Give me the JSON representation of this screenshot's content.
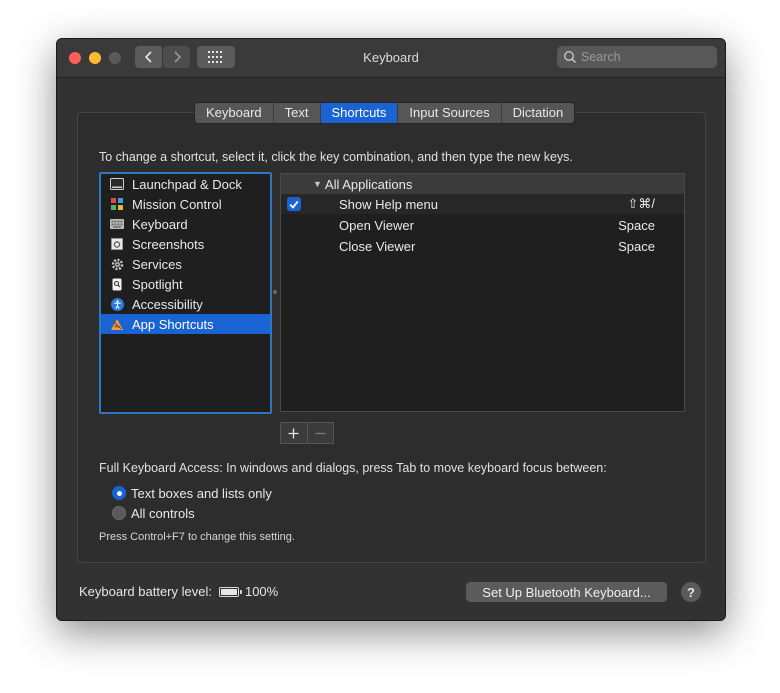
{
  "window": {
    "title": "Keyboard",
    "search_placeholder": "Search"
  },
  "tabs": [
    {
      "label": "Keyboard",
      "active": false
    },
    {
      "label": "Text",
      "active": false
    },
    {
      "label": "Shortcuts",
      "active": true
    },
    {
      "label": "Input Sources",
      "active": false
    },
    {
      "label": "Dictation",
      "active": false
    }
  ],
  "instruction": "To change a shortcut, select it, click the key combination, and then type the new keys.",
  "categories": [
    {
      "label": "Launchpad & Dock",
      "icon": "launchpad-dock-icon",
      "selected": false
    },
    {
      "label": "Mission Control",
      "icon": "mission-control-icon",
      "selected": false
    },
    {
      "label": "Keyboard",
      "icon": "keyboard-icon",
      "selected": false
    },
    {
      "label": "Screenshots",
      "icon": "screenshot-icon",
      "selected": false
    },
    {
      "label": "Services",
      "icon": "gear-icon",
      "selected": false
    },
    {
      "label": "Spotlight",
      "icon": "spotlight-icon",
      "selected": false
    },
    {
      "label": "Accessibility",
      "icon": "accessibility-icon",
      "selected": false
    },
    {
      "label": "App Shortcuts",
      "icon": "app-shortcuts-icon",
      "selected": true
    }
  ],
  "shortcuts": {
    "group_label": "All Applications",
    "rows": [
      {
        "label": "Show Help menu",
        "key": "⇧⌘/",
        "checked": true
      },
      {
        "label": "Open Viewer",
        "key": "Space",
        "checked": false
      },
      {
        "label": "Close Viewer",
        "key": "Space",
        "checked": false
      }
    ]
  },
  "full_keyboard_access": {
    "label": "Full Keyboard Access: In windows and dialogs, press Tab to move keyboard focus between:",
    "options": [
      {
        "label": "Text boxes and lists only",
        "selected": true
      },
      {
        "label": "All controls",
        "selected": false
      }
    ],
    "hint": "Press Control+F7 to change this setting."
  },
  "battery": {
    "label": "Keyboard battery level:",
    "value": "100%",
    "level": 1.0
  },
  "bluetooth_button": "Set Up Bluetooth Keyboard...",
  "help_button": "?",
  "colors": {
    "accent": "#1a63d3",
    "window_bg": "#323232"
  }
}
